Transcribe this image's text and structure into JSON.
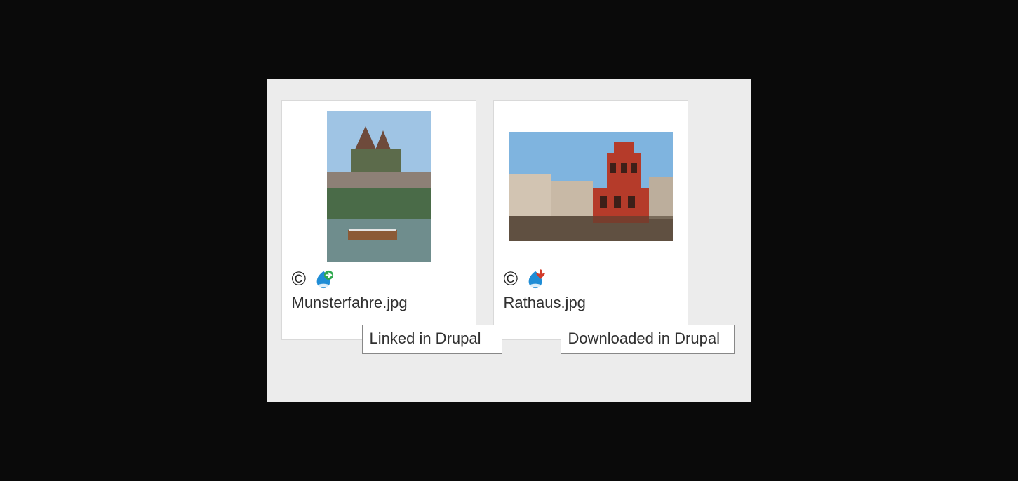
{
  "items": [
    {
      "filename": "Munsterfahre.jpg",
      "copyright_symbol": "©",
      "status_kind": "linked",
      "tooltip": "Linked in Drupal"
    },
    {
      "filename": "Rathaus.jpg",
      "copyright_symbol": "©",
      "status_kind": "downloaded",
      "tooltip": "Downloaded in Drupal"
    }
  ]
}
